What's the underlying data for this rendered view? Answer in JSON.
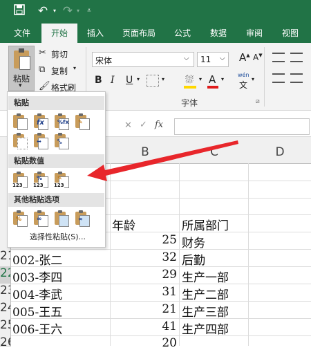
{
  "quick_access": {
    "save_icon": "save-icon",
    "undo_icon": "undo-icon",
    "redo_icon": "redo-icon",
    "customize_icon": "customize-icon"
  },
  "tabs": [
    "文件",
    "开始",
    "插入",
    "页面布局",
    "公式",
    "数据",
    "审阅",
    "视图"
  ],
  "active_tab": "开始",
  "clipboard": {
    "paste_label": "粘贴",
    "cut_label": "剪切",
    "copy_label": "复制",
    "format_painter_label": "格式刷"
  },
  "font": {
    "name": "宋体",
    "size": "11",
    "group_label": "字体",
    "bold": "B",
    "italic": "I",
    "underline": "U",
    "font_color": "A",
    "phonetic_top": "wén",
    "phonetic_bottom": "文"
  },
  "formula_bar": {
    "fx": "fx",
    "cancel": "✕",
    "enter": "✓"
  },
  "paste_menu": {
    "section_paste": "粘贴",
    "section_paste_values": "粘贴数值",
    "section_other": "其他粘贴选项",
    "paste_special": "选择性粘贴(S)...",
    "values_badge": "123"
  },
  "columns": [
    "B",
    "C",
    "D"
  ],
  "rows": [
    {
      "num": "",
      "a": "",
      "b": "",
      "c": ""
    },
    {
      "num": "",
      "a": "",
      "b": "年龄",
      "c": "所属部门"
    },
    {
      "num": "",
      "a": "",
      "b": "25",
      "c": "财务"
    },
    {
      "num": "21",
      "a": "002-张二",
      "b": "32",
      "c": "后勤"
    },
    {
      "num": "22",
      "a": "003-李四",
      "b": "29",
      "c": "生产一部"
    },
    {
      "num": "23",
      "a": "004-李武",
      "b": "31",
      "c": "生产二部"
    },
    {
      "num": "24",
      "a": "005-王五",
      "b": "21",
      "c": "生产三部"
    },
    {
      "num": "25",
      "a": "006-王六",
      "b": "41",
      "c": "生产四部"
    },
    {
      "num": "26",
      "a": "",
      "b": "20",
      "c": ""
    }
  ],
  "colors": {
    "excel_green": "#217346",
    "arrow_red": "#e8262b"
  }
}
